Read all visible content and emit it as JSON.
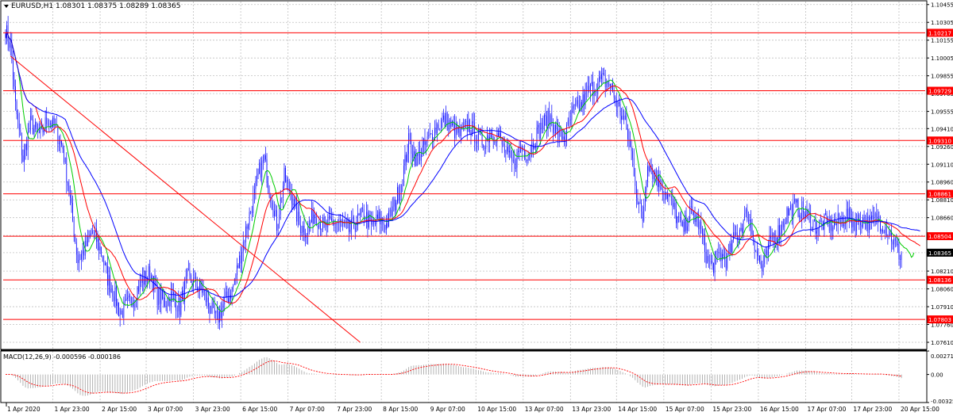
{
  "header": {
    "symbol_info": "EURUSD,H1  1.08301 1.08375 1.08289 1.08365"
  },
  "macd_panel": {
    "label": "MACD(12,26,9) -0.000596 -0.000186"
  },
  "chart_data": [
    {
      "type": "candlestick",
      "symbol": "EURUSD",
      "timeframe": "H1",
      "ylim": [
        1.0755,
        1.1048
      ],
      "y_ticks": [
        "1.10455",
        "1.10305",
        "1.10155",
        "1.10005",
        "1.09855",
        "1.09705",
        "1.09555",
        "1.09410",
        "1.09260",
        "1.09110",
        "1.08960",
        "1.08810",
        "1.08660",
        "1.08510",
        "1.08365",
        "1.08210",
        "1.08060",
        "1.07910",
        "1.07760",
        "1.07610"
      ],
      "x_ticks": [
        "1 Apr 2020",
        "1 Apr 23:00",
        "2 Apr 15:00",
        "3 Apr 07:00",
        "3 Apr 23:00",
        "6 Apr 15:00",
        "7 Apr 07:00",
        "7 Apr 23:00",
        "8 Apr 15:00",
        "9 Apr 07:00",
        "10 Apr 15:00",
        "13 Apr 07:00",
        "13 Apr 23:00",
        "14 Apr 15:00",
        "15 Apr 07:00",
        "15 Apr 23:00",
        "16 Apr 15:00",
        "17 Apr 07:00",
        "17 Apr 23:00",
        "20 Apr 15:00"
      ],
      "current_price": "1.08365",
      "levels": [
        {
          "label": "1.10217",
          "value": 1.10217
        },
        {
          "label": "1.09729",
          "value": 1.09729
        },
        {
          "label": "1.09310",
          "value": 1.0931
        },
        {
          "label": "1.08861",
          "value": 1.08861
        },
        {
          "label": "1.08504",
          "value": 1.08504
        },
        {
          "label": "1.08136",
          "value": 1.08136
        },
        {
          "label": "1.07803",
          "value": 1.07803
        }
      ],
      "trendline": {
        "from": {
          "bar": 4,
          "price": 1.1002
        },
        "to": {
          "bar": 285,
          "price": 1.0761
        }
      },
      "anchors": [
        [
          0,
          1.1025
        ],
        [
          4,
          1.101
        ],
        [
          8,
          1.096
        ],
        [
          14,
          1.0915
        ],
        [
          20,
          1.0945
        ],
        [
          28,
          1.0935
        ],
        [
          34,
          1.095
        ],
        [
          40,
          1.094
        ],
        [
          46,
          1.0925
        ],
        [
          52,
          1.088
        ],
        [
          58,
          1.083
        ],
        [
          64,
          1.084
        ],
        [
          70,
          1.0855
        ],
        [
          76,
          1.084
        ],
        [
          82,
          1.0815
        ],
        [
          88,
          1.08
        ],
        [
          92,
          1.0785
        ],
        [
          100,
          1.0795
        ],
        [
          108,
          1.081
        ],
        [
          116,
          1.082
        ],
        [
          122,
          1.08
        ],
        [
          128,
          1.0795
        ],
        [
          134,
          1.08
        ],
        [
          140,
          1.079
        ],
        [
          146,
          1.0815
        ],
        [
          152,
          1.081
        ],
        [
          158,
          1.0805
        ],
        [
          164,
          1.079
        ],
        [
          170,
          1.078
        ],
        [
          176,
          1.0795
        ],
        [
          182,
          1.0805
        ],
        [
          188,
          1.083
        ],
        [
          194,
          1.086
        ],
        [
          200,
          1.0885
        ],
        [
          204,
          1.0905
        ],
        [
          208,
          1.0915
        ],
        [
          212,
          1.089
        ],
        [
          218,
          1.086
        ],
        [
          224,
          1.09
        ],
        [
          230,
          1.0885
        ],
        [
          236,
          1.086
        ],
        [
          242,
          1.0855
        ],
        [
          248,
          1.087
        ],
        [
          256,
          1.0858
        ],
        [
          264,
          1.0862
        ],
        [
          270,
          1.086
        ],
        [
          276,
          1.0855
        ],
        [
          282,
          1.0862
        ],
        [
          288,
          1.087
        ],
        [
          294,
          1.0858
        ],
        [
          300,
          1.0865
        ],
        [
          306,
          1.086
        ],
        [
          312,
          1.0875
        ],
        [
          318,
          1.0895
        ],
        [
          324,
          1.093
        ],
        [
          330,
          1.0915
        ],
        [
          336,
          1.0925
        ],
        [
          342,
          1.0935
        ],
        [
          348,
          1.0945
        ],
        [
          354,
          1.0948
        ],
        [
          360,
          1.094
        ],
        [
          366,
          1.0935
        ],
        [
          372,
          1.0945
        ],
        [
          378,
          1.0935
        ],
        [
          384,
          1.093
        ],
        [
          390,
          1.0938
        ],
        [
          396,
          1.0935
        ],
        [
          402,
          1.092
        ],
        [
          408,
          1.091
        ],
        [
          414,
          1.0925
        ],
        [
          420,
          1.092
        ],
        [
          426,
          1.0935
        ],
        [
          432,
          1.0945
        ],
        [
          438,
          1.095
        ],
        [
          444,
          1.0935
        ],
        [
          450,
          1.0935
        ],
        [
          456,
          1.0955
        ],
        [
          462,
          1.096
        ],
        [
          468,
          1.0972
        ],
        [
          474,
          1.0978
        ],
        [
          480,
          1.0982
        ],
        [
          486,
          1.0978
        ],
        [
          492,
          1.096
        ],
        [
          498,
          1.0945
        ],
        [
          504,
          1.0915
        ],
        [
          508,
          1.088
        ],
        [
          512,
          1.0865
        ],
        [
          516,
          1.0915
        ],
        [
          520,
          1.0905
        ],
        [
          526,
          1.0895
        ],
        [
          532,
          1.0885
        ],
        [
          538,
          1.087
        ],
        [
          544,
          1.0855
        ],
        [
          550,
          1.087
        ],
        [
          556,
          1.0865
        ],
        [
          560,
          1.085
        ],
        [
          564,
          1.083
        ],
        [
          568,
          1.0825
        ],
        [
          574,
          1.0835
        ],
        [
          580,
          1.083
        ],
        [
          586,
          1.085
        ],
        [
          592,
          1.086
        ],
        [
          596,
          1.087
        ],
        [
          600,
          1.0855
        ],
        [
          604,
          1.0835
        ],
        [
          608,
          1.0822
        ],
        [
          612,
          1.0835
        ],
        [
          616,
          1.085
        ],
        [
          622,
          1.0855
        ],
        [
          628,
          1.087
        ],
        [
          634,
          1.0875
        ],
        [
          640,
          1.0872
        ],
        [
          646,
          1.0865
        ],
        [
          652,
          1.0858
        ],
        [
          658,
          1.0862
        ],
        [
          664,
          1.086
        ],
        [
          670,
          1.0862
        ],
        [
          676,
          1.0868
        ],
        [
          682,
          1.0862
        ],
        [
          688,
          1.0865
        ],
        [
          694,
          1.086
        ],
        [
          700,
          1.0865
        ],
        [
          706,
          1.086
        ],
        [
          712,
          1.085
        ],
        [
          716,
          1.084
        ],
        [
          720,
          1.0832
        ]
      ],
      "moving_averages": [
        {
          "period": 5,
          "color": "#00cc00"
        },
        {
          "period": 12,
          "color": "#ff0000"
        },
        {
          "period": 24,
          "color": "#0000ff"
        }
      ]
    },
    {
      "type": "histogram",
      "indicator": "MACD",
      "ylim": [
        -0.003253,
        0.002719
      ],
      "y_ticks": [
        "0.002719",
        "0.00",
        "-0.003253"
      ]
    }
  ],
  "colors": {
    "candle": "#0000ff",
    "level": "#ff0000",
    "trendline": "#ff0000",
    "grid": "#c0c0c0",
    "macd_hist": "#a0a0a0",
    "macd_signal": "#ff0000",
    "price_tag_bg": "#000000",
    "level_tag_bg": "#ff0000"
  }
}
